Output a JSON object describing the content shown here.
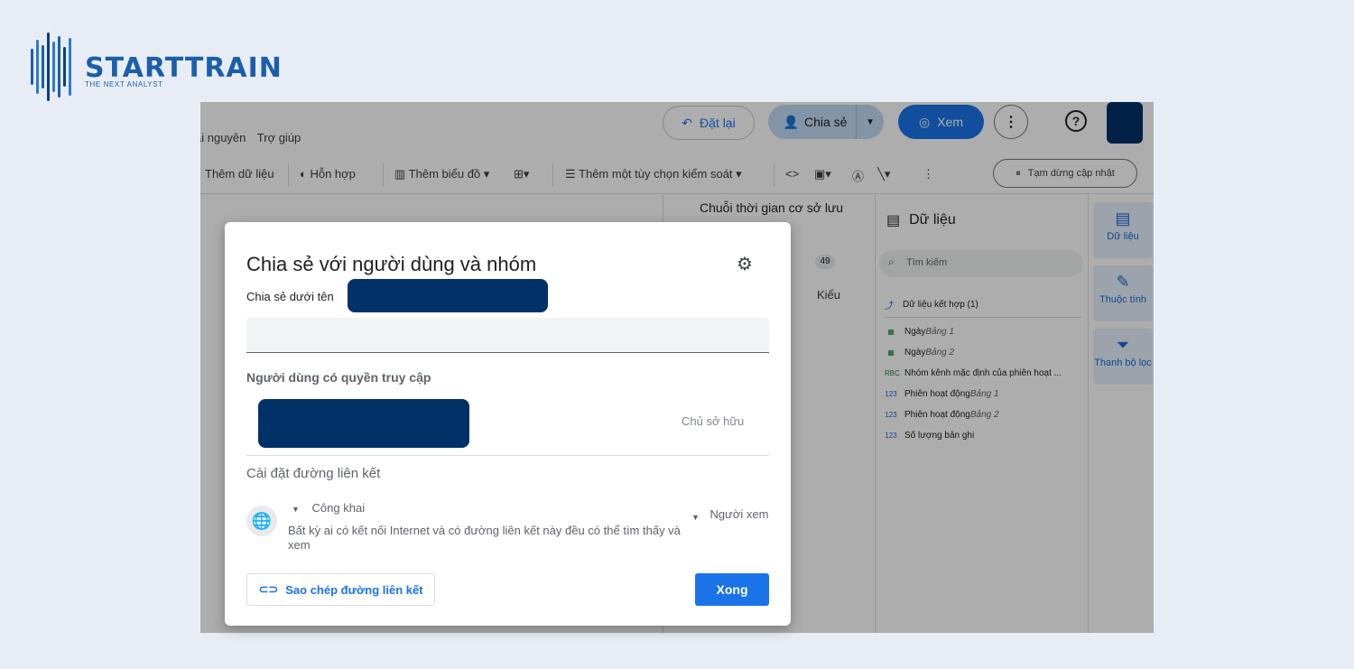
{
  "brand": {
    "name": "STARTTRAIN",
    "tagline": "THE NEXT ANALYST"
  },
  "menu": {
    "items": [
      "ài nguyên",
      "Trợ giúp"
    ]
  },
  "header": {
    "reset_label": "Đặt lại",
    "share_label": "Chia sẻ",
    "view_label": "Xem"
  },
  "toolbar": {
    "add_data": "Thêm dữ liệu",
    "blend": "Hỗn hợp",
    "add_chart": "Thêm biểu đồ",
    "add_control": "Thêm một tùy chọn kiểm soát",
    "pause_update": "Tạm dừng cập nhật"
  },
  "properties": {
    "title": "Chuỗi thời gian cơ sở lưu",
    "count_badge": "49",
    "style_tab": "Kiểu"
  },
  "data_panel": {
    "title": "Dữ liệu",
    "search_placeholder": "Tìm kiếm",
    "blend_source": "Dữ liệu kết hợp (1)",
    "fields": [
      {
        "type": "date",
        "name": "Ngày",
        "table": "Bảng 1"
      },
      {
        "type": "date",
        "name": "Ngày",
        "table": "Bảng 2"
      },
      {
        "type": "text",
        "name": "Nhóm kênh mặc định của phiên hoạt ...",
        "table": ""
      },
      {
        "type": "number",
        "name": "Phiên hoạt động",
        "table": "Bảng 1"
      },
      {
        "type": "number",
        "name": "Phiên hoạt động",
        "table": "Bảng 2"
      },
      {
        "type": "number",
        "name": "Số lượng bản ghi",
        "table": ""
      }
    ]
  },
  "side_tabs": [
    {
      "label": "Dữ liệu",
      "icon": "table-icon"
    },
    {
      "label": "Thuộc tính",
      "icon": "pencil-icon"
    },
    {
      "label": "Thanh bộ lọc",
      "icon": "filter-icon"
    }
  ],
  "dialog": {
    "title": "Chia sẻ với người dùng và nhóm",
    "share_as_label": "Chia sẻ dưới tên",
    "access_header": "Người dùng có quyền truy cập",
    "owner_role": "Chủ sở hữu",
    "link_settings_header": "Cài đặt đường liên kết",
    "link_visibility": "Công khai",
    "link_description": "Bất kỳ ai có kết nối Internet và có đường liên kết này đều có thể tìm thấy và xem",
    "link_role": "Người xem",
    "copy_link_label": "Sao chép đường liên kết",
    "done_label": "Xong"
  },
  "colors": {
    "accent": "#1a73e8",
    "redaction": "#023168",
    "brand": "#1b5fab"
  }
}
